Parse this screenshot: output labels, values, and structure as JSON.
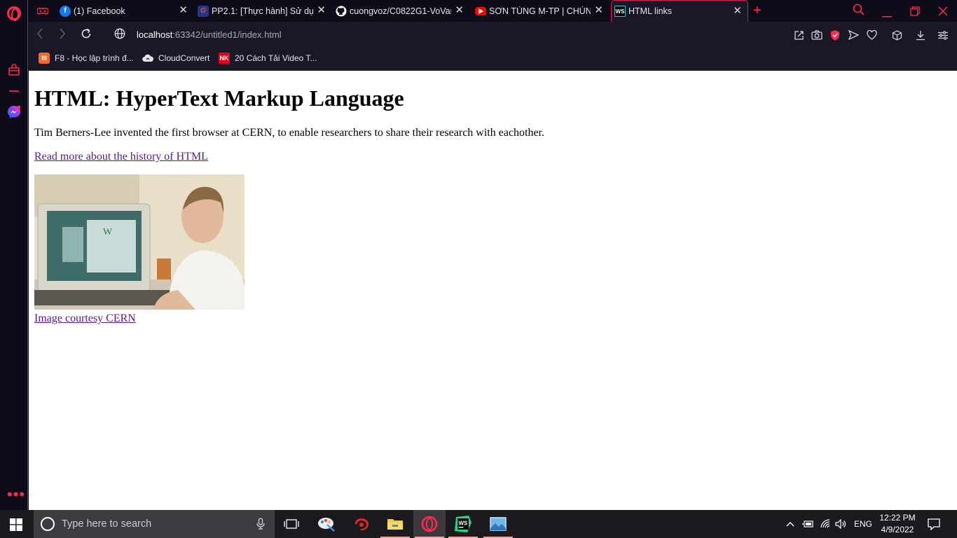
{
  "browser": {
    "tabs": [
      {
        "title": "",
        "icon": "gamepad-icon"
      },
      {
        "title": "(1) Facebook",
        "icon": "facebook-icon"
      },
      {
        "title": "PP2.1: [Thực hành] Sử dụng",
        "icon": "codegym-icon"
      },
      {
        "title": "cuongvoz/C0822G1-VoVan",
        "icon": "github-icon"
      },
      {
        "title": "SƠN TÙNG M-TP | CHÚNG",
        "icon": "youtube-icon"
      },
      {
        "title": "HTML links",
        "icon": "webstorm-icon",
        "active": true
      }
    ],
    "url_host": "localhost",
    "url_rest": ":63342/untitled1/index.html",
    "bookmarks": [
      {
        "label": "F8 - Học lập trình đ...",
        "icon": "f8-icon",
        "badge": "f8"
      },
      {
        "label": "CloudConvert",
        "icon": "cloudconvert-icon"
      },
      {
        "label": "20 Cách Tải Video T...",
        "icon": "nk-icon",
        "badge": "NK"
      }
    ],
    "accent_color": "#ff2a4d"
  },
  "page": {
    "heading": "HTML: HyperText Markup Language",
    "description": "Tim Berners-Lee invented the first browser at CERN, to enable researchers to share their research with eachother.",
    "history_link": "Read more about the history of HTML",
    "image_caption_link": "Image courtesy CERN"
  },
  "taskbar": {
    "search_placeholder": "Type here to search",
    "language": "ENG",
    "time": "12:22 PM",
    "date": "4/9/2022"
  }
}
